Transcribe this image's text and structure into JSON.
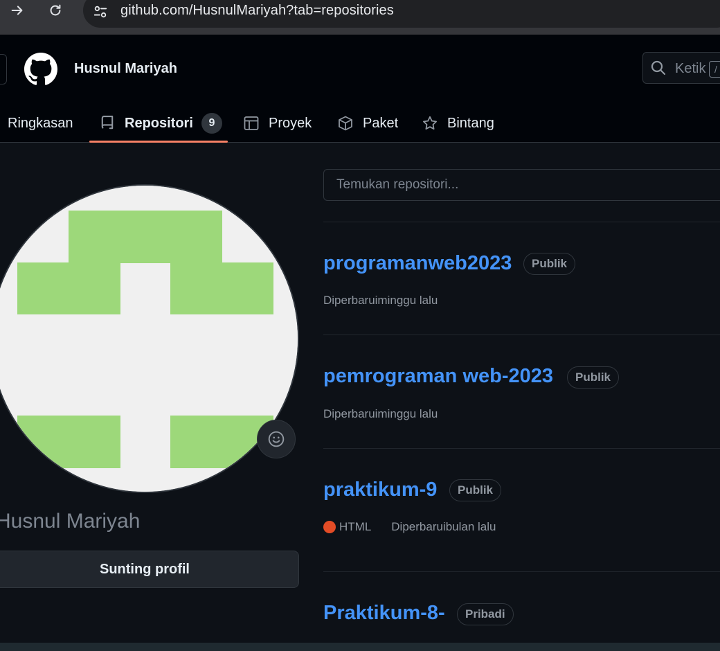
{
  "browser": {
    "url": "github.com/HusnulMariyah?tab=repositories"
  },
  "header": {
    "username": "Husnul Mariyah",
    "search_placeholder": "Ketik",
    "search_kbd": "/"
  },
  "tabs": [
    {
      "label": "Ringkasan",
      "icon": "book-open-icon"
    },
    {
      "label": "Repositori",
      "icon": "repo-icon",
      "count": "9",
      "active": true
    },
    {
      "label": "Proyek",
      "icon": "table-icon"
    },
    {
      "label": "Paket",
      "icon": "package-icon"
    },
    {
      "label": "Bintang",
      "icon": "star-icon"
    }
  ],
  "profile": {
    "name": "Husnul Mariyah",
    "edit_label": "Sunting profil",
    "avatar_color": "#9dd87a"
  },
  "repo_search": {
    "placeholder": "Temukan repositori..."
  },
  "repos": [
    {
      "name": "programanweb2023",
      "visibility": "Publik",
      "updated": "Diperbaruiminggu lalu"
    },
    {
      "name": "pemrograman web-2023",
      "visibility": "Publik",
      "updated": "Diperbaruiminggu lalu"
    },
    {
      "name": "praktikum-9",
      "visibility": "Publik",
      "language": "HTML",
      "language_color": "#e34c26",
      "updated": "Diperbaruibulan lalu"
    },
    {
      "name": "Praktikum-8-",
      "visibility": "Pribadi"
    }
  ],
  "colors": {
    "link": "#4493f8",
    "tab_underline": "#f78166",
    "background": "#0d1117"
  }
}
